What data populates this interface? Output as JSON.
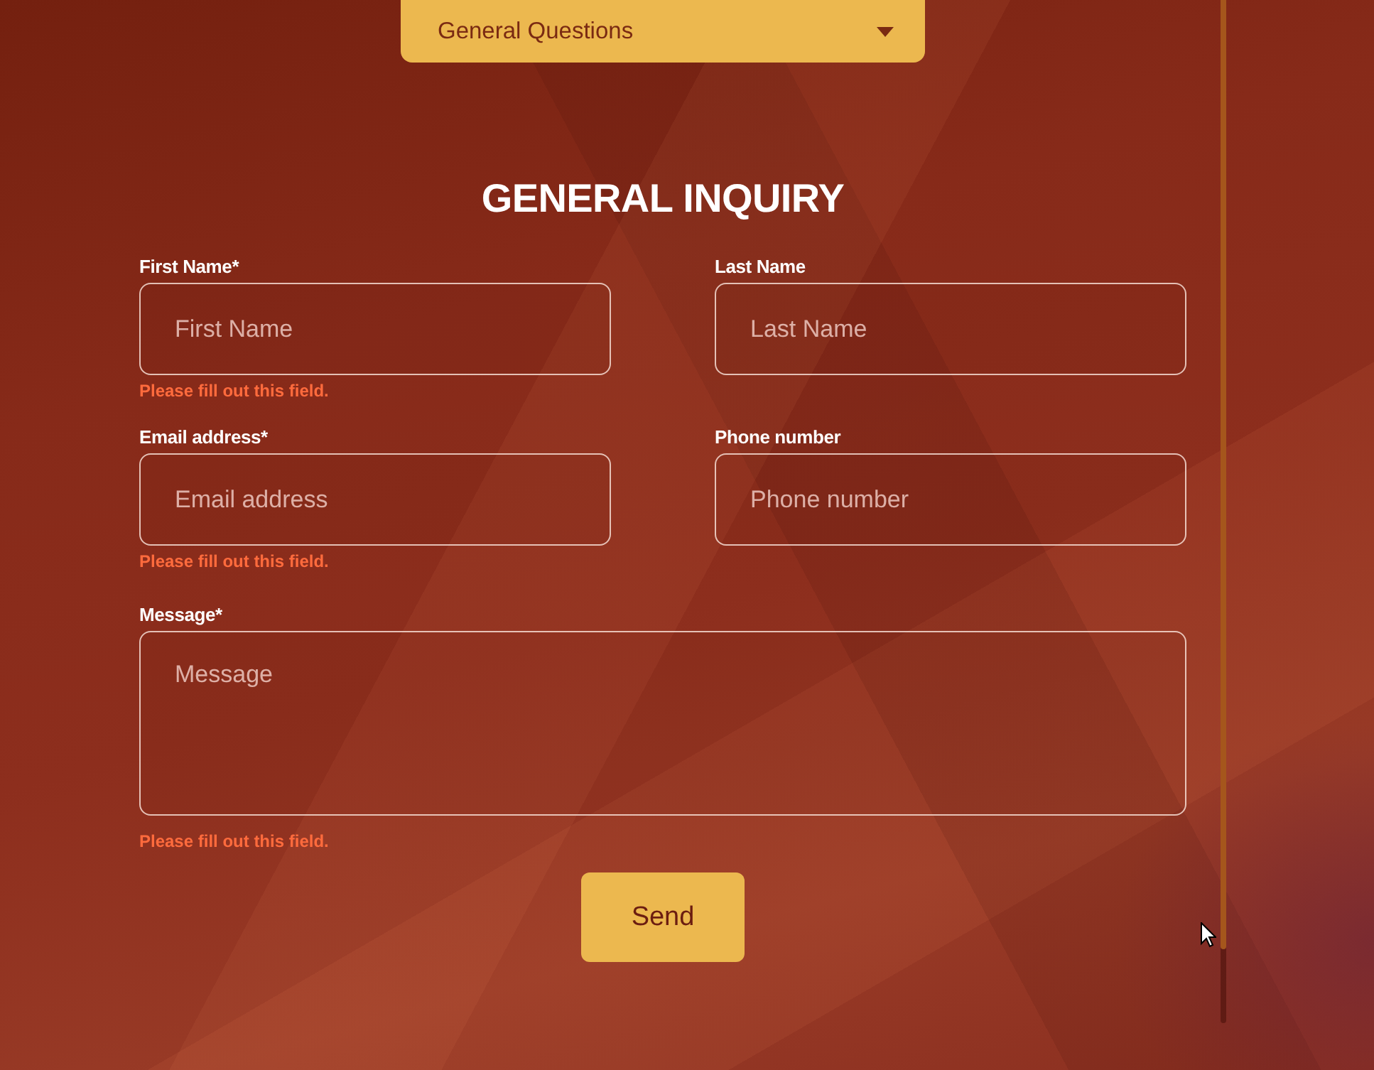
{
  "category_select": {
    "value": "General Questions"
  },
  "heading": "GENERAL INQUIRY",
  "fields": [
    {
      "kind": "input",
      "label": "First Name*",
      "placeholder": "First Name",
      "error": "Please fill out this field."
    },
    {
      "kind": "input",
      "label": "Last Name",
      "placeholder": "Last Name"
    },
    {
      "kind": "input",
      "label": "Email address*",
      "placeholder": "Email address",
      "error": "Please fill out this field."
    },
    {
      "kind": "input",
      "label": "Phone number",
      "placeholder": "Phone number"
    },
    {
      "kind": "textarea",
      "label": "Message*",
      "placeholder": "Message",
      "error": "Please fill out this field."
    }
  ],
  "submit_button": {
    "label": "Send"
  }
}
